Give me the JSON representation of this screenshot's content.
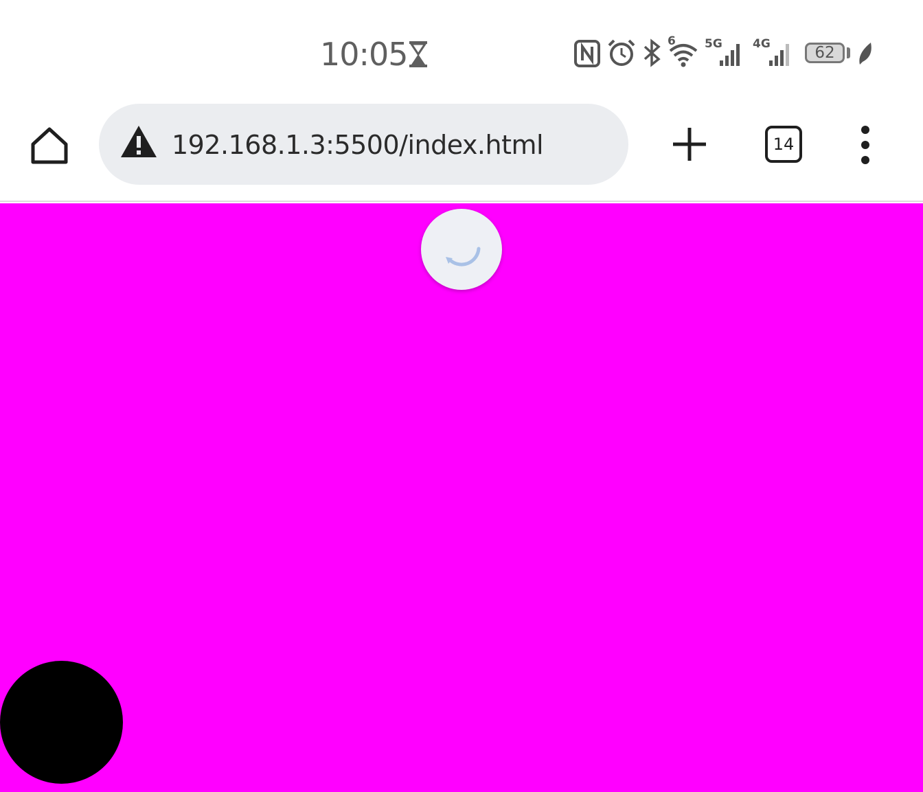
{
  "status_bar": {
    "time": "10:05",
    "icons": [
      "hourglass-icon",
      "nfc-icon",
      "alarm-icon",
      "bluetooth-icon",
      "wifi-6-icon",
      "signal-5g-icon",
      "signal-4g-icon",
      "battery-icon",
      "leaf-icon"
    ],
    "wifi_label": "6",
    "signal_1_label": "5G",
    "signal_2_label": "4G",
    "battery_level": "62"
  },
  "toolbar": {
    "url": "192.168.1.3:5500/index.html",
    "tab_count": "14"
  },
  "page": {
    "background_color": "#ff00ff",
    "circle_color": "#000000",
    "loading": true
  }
}
